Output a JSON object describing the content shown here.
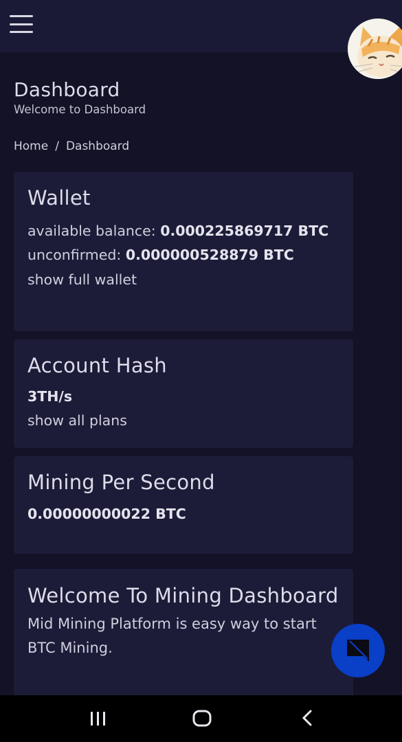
{
  "header": {
    "menu_icon": "hamburger-menu-icon",
    "avatar": "cat-avatar"
  },
  "page": {
    "title": "Dashboard",
    "subtitle": "Welcome to Dashboard"
  },
  "breadcrumb": {
    "home": "Home",
    "separator": "/",
    "current": "Dashboard"
  },
  "wallet": {
    "title": "Wallet",
    "available_label": "available balance:",
    "available_value": "0.000225869717 BTC",
    "unconfirmed_label": "unconfirmed:",
    "unconfirmed_value": "0.000000528879 BTC",
    "link": "show full wallet"
  },
  "account_hash": {
    "title": "Account Hash",
    "value": "3TH/s",
    "link": "show all plans"
  },
  "mining_per_second": {
    "title": "Mining Per Second",
    "value": "0.00000000022 BTC"
  },
  "welcome": {
    "title": "Welcome To Mining Dashboard",
    "description": "Mid Mining Platform is easy way to start BTC Mining."
  },
  "chat_button": {
    "icon": "chat-bubble-icon"
  },
  "system_nav": {
    "recents_icon": "recents-icon",
    "home_icon": "home-icon",
    "back_icon": "back-icon"
  },
  "colors": {
    "background": "#131226",
    "topbar": "#1b1a36",
    "card": "#1d1c38",
    "accent": "#0a3fc7"
  }
}
